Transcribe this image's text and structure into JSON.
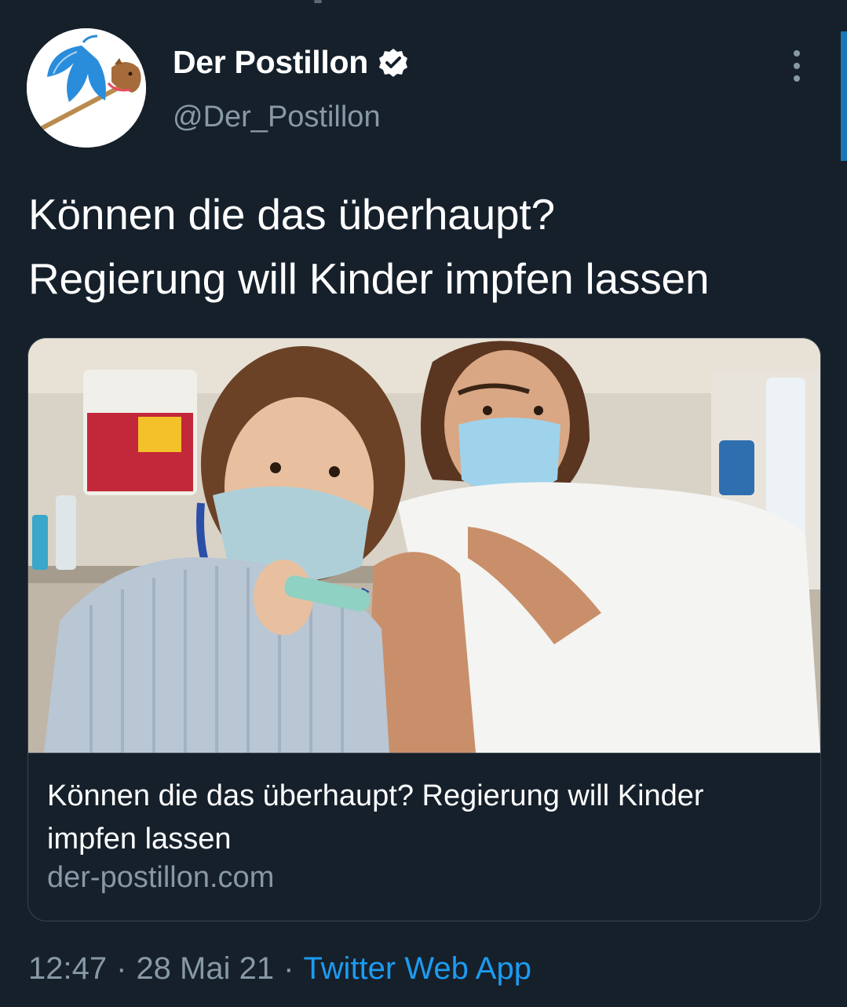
{
  "tweet": {
    "display_name": "Der Postillon",
    "handle": "@Der_Postillon",
    "verified_icon": "verified-badge-icon",
    "text_line1": "Können die das überhaupt?",
    "text_line2": "Regierung will Kinder impfen lassen",
    "time": "12:47",
    "separator": "·",
    "date": "28 Mai 21",
    "source": "Twitter Web App"
  },
  "card": {
    "title": "Können die das überhaupt? Regierung will Kinder impfen lassen",
    "domain": "der-postillon.com",
    "image_subject": "child-with-toy-syringe-and-man-with-mask-photo"
  },
  "colors": {
    "background": "#15202b",
    "text": "#ffffff",
    "secondary": "#8899a6",
    "accent": "#1d9bf0",
    "border": "#38444d"
  }
}
